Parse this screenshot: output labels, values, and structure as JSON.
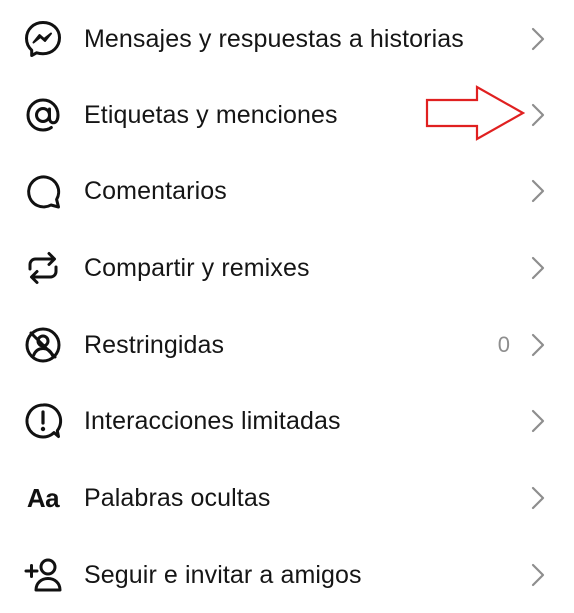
{
  "menu": {
    "items": [
      {
        "label": "Mensajes y respuestas a historias",
        "icon": "messenger-icon"
      },
      {
        "label": "Etiquetas y menciones",
        "icon": "at-sign-icon"
      },
      {
        "label": "Comentarios",
        "icon": "comment-bubble-icon"
      },
      {
        "label": "Compartir y remixes",
        "icon": "repeat-icon"
      },
      {
        "label": "Restringidas",
        "icon": "restricted-icon",
        "count": "0"
      },
      {
        "label": "Interacciones limitadas",
        "icon": "alert-circle-icon"
      },
      {
        "label": "Palabras ocultas",
        "icon": "aa-text-icon",
        "icon_text": "Aa"
      },
      {
        "label": "Seguir e invitar a amigos",
        "icon": "add-person-icon"
      }
    ]
  },
  "colors": {
    "text": "#151515",
    "secondary_text": "#8e8e8e",
    "chevron": "#8e8e8e",
    "annotation_arrow": "#e02020"
  }
}
